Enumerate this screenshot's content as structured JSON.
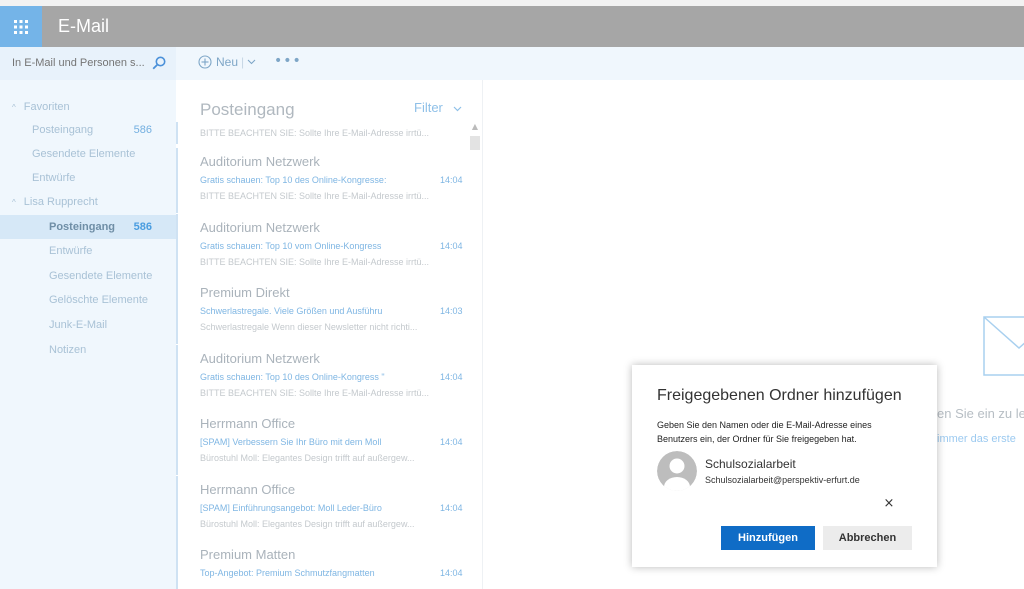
{
  "app": {
    "title": "E-Mail"
  },
  "search": {
    "placeholder": "In E-Mail und Personen s..."
  },
  "toolbar": {
    "new_label": "Neu",
    "more_label": "•••"
  },
  "sidebar": {
    "favorites_label": "Favoriten",
    "favorites": [
      {
        "label": "Posteingang",
        "count": "586"
      },
      {
        "label": "Gesendete Elemente"
      },
      {
        "label": "Entwürfe"
      }
    ],
    "account_label": "Lisa Rupprecht",
    "folders": [
      {
        "label": "Posteingang",
        "count": "586"
      },
      {
        "label": "Entwürfe"
      },
      {
        "label": "Gesendete Elemente"
      },
      {
        "label": "Gelöschte Elemente"
      },
      {
        "label": "Junk-E-Mail"
      },
      {
        "label": "Notizen"
      }
    ]
  },
  "list": {
    "title": "Posteingang",
    "filter_label": "Filter",
    "first_preview": "BITTE BEACHTEN SIE: Sollte Ihre E-Mail-Adresse irrtü...",
    "messages": [
      {
        "from": "Auditorium Netzwerk",
        "subject": "Gratis schauen: Top 10 des Online-Kongresse:",
        "time": "14:04",
        "preview": "BITTE BEACHTEN SIE: Sollte Ihre E-Mail-Adresse irrtü..."
      },
      {
        "from": "Auditorium Netzwerk",
        "subject": "Gratis schauen: Top 10 vom Online-Kongress",
        "time": "14:04",
        "preview": "BITTE BEACHTEN SIE: Sollte Ihre E-Mail-Adresse irrtü..."
      },
      {
        "from": "Premium Direkt",
        "subject": "Schwerlastregale. Viele Größen und Ausführu",
        "time": "14:03",
        "preview": "Schwerlastregale Wenn dieser Newsletter nicht richti..."
      },
      {
        "from": "Auditorium Netzwerk",
        "subject": "Gratis schauen: Top 10 des Online-Kongress \"",
        "time": "14:04",
        "preview": "BITTE BEACHTEN SIE: Sollte Ihre E-Mail-Adresse irrtü..."
      },
      {
        "from": "Herrmann Office",
        "subject": "[SPAM] Verbessern Sie Ihr Büro mit dem Moll",
        "time": "14:04",
        "preview": "Bürostuhl Moll: Elegantes Design trifft auf außergew..."
      },
      {
        "from": "Herrmann Office",
        "subject": "[SPAM] Einführungsangebot: Moll Leder-Büro",
        "time": "14:04",
        "preview": "Bürostuhl Moll: Elegantes Design trifft auf außergew..."
      },
      {
        "from": "Premium Matten",
        "subject": "Top-Angebot: Premium Schmutzfangmatten",
        "time": "14:04",
        "preview": ""
      }
    ]
  },
  "reading": {
    "text1": "en Sie ein zu le",
    "text2": "immer das erste"
  },
  "dialog": {
    "title": "Freigegebenen Ordner hinzufügen",
    "description": "Geben Sie den Namen oder die E-Mail-Adresse eines Benutzers ein, der Ordner für Sie freigegeben hat.",
    "person_name": "Schulsozialarbeit",
    "person_email": "Schulsozialarbeit@perspektiv-erfurt.de",
    "remove_label": "×",
    "add_label": "Hinzufügen",
    "cancel_label": "Abbrechen"
  },
  "colors": {
    "topbar": "#a6a6a6",
    "waffle": "#74b4e8",
    "accent": "#0f6cc6",
    "pane": "#f0f7fd"
  }
}
